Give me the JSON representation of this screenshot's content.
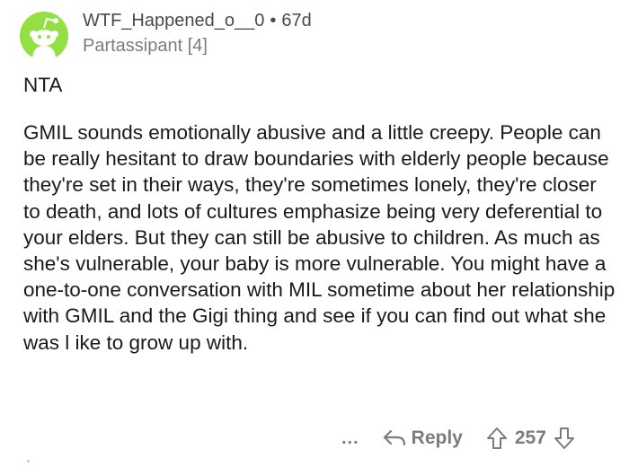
{
  "comment": {
    "author": "WTF_Happened_o__0",
    "separator": "•",
    "age": "67d",
    "flair": "Partassipant [4]",
    "paragraphs": [
      "NTA",
      "GMIL sounds emotionally abusive and a little creepy. People can be really hesitant to draw boundaries with elderly people because they're set in their ways, they're sometimes lonely, they're closer to death, and lots of cultures emphasize being very deferential to your elders. But they can still be abusive to children. As much as she's vulnerable, your baby is more vulnerable. You might have a one-to-one conversation with MIL sometime about her relationship with GMIL and the Gigi thing and see if you can find out what she was l ike to grow up with."
    ]
  },
  "actions": {
    "more": "...",
    "reply": "Reply",
    "score": "257"
  },
  "colors": {
    "avatar_bg": "#94e044",
    "meta_text": "#7c7c7c",
    "body_text": "#1a1a1b"
  },
  "icons": {
    "avatar": "snoo-avatar-icon",
    "reply": "reply-arrow-icon",
    "upvote": "upvote-arrow-icon",
    "downvote": "downvote-arrow-icon"
  }
}
